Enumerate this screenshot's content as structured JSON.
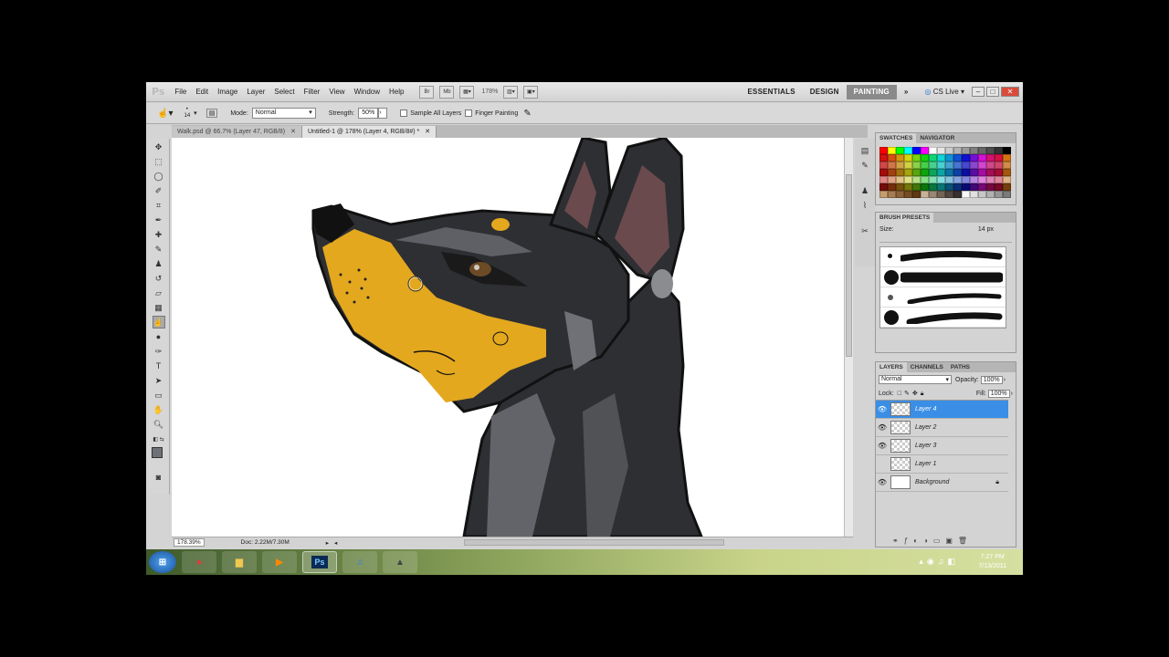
{
  "menubar": {
    "logo": "Ps",
    "items": [
      "File",
      "Edit",
      "Image",
      "Layer",
      "Select",
      "Filter",
      "View",
      "Window",
      "Help"
    ],
    "bridge": "Br",
    "minibridge": "Mb",
    "zoom": "178%",
    "workspaces": [
      "ESSENTIALS",
      "DESIGN",
      "PAINTING"
    ],
    "active_workspace": "PAINTING",
    "more": "»",
    "cslive": "CS Live"
  },
  "options": {
    "brush_size": "14",
    "mode_label": "Mode:",
    "mode_value": "Normal",
    "strength_label": "Strength:",
    "strength_value": "50%",
    "sample_all_layers": "Sample All Layers",
    "finger_painting": "Finger Painting"
  },
  "tabs": [
    {
      "label": "Walk.psd @ 66.7% (Layer 47, RGB/8)"
    },
    {
      "label": "Untitled-1 @ 178% (Layer 4, RGB/8#) *"
    }
  ],
  "status": {
    "zoom": "178.39%",
    "doc": "Doc: 2.22M/7.30M"
  },
  "swatches": {
    "tabs": [
      "SWATCHES",
      "NAVIGATOR"
    ]
  },
  "brush_presets": {
    "tab": "BRUSH PRESETS",
    "size_label": "Size:",
    "size_value": "14 px"
  },
  "layers": {
    "tabs": [
      "LAYERS",
      "CHANNELS",
      "PATHS"
    ],
    "blend": "Normal",
    "opacity_label": "Opacity:",
    "opacity_value": "100%",
    "lock_label": "Lock:",
    "fill_label": "Fill:",
    "fill_value": "100%",
    "items": [
      {
        "name": "Layer 4",
        "visible": true,
        "selected": true
      },
      {
        "name": "Layer 2",
        "visible": true,
        "selected": false
      },
      {
        "name": "Layer 3",
        "visible": true,
        "selected": false
      },
      {
        "name": "Layer 1",
        "visible": false,
        "selected": false
      },
      {
        "name": "Background",
        "visible": true,
        "selected": false
      }
    ]
  },
  "taskbar": {
    "time": "7:27 PM",
    "date": "7/13/2011",
    "apps": [
      "start-orb-icon",
      "chrome-icon",
      "explorer-icon",
      "media-player-icon",
      "photoshop-icon",
      "itunes-icon",
      "app-icon"
    ]
  },
  "colors": {
    "accent_selected": "#3a8ee6",
    "dog_black": "#2e2f33",
    "dog_tan": "#e3a81e",
    "dog_gray": "#6f7176"
  }
}
